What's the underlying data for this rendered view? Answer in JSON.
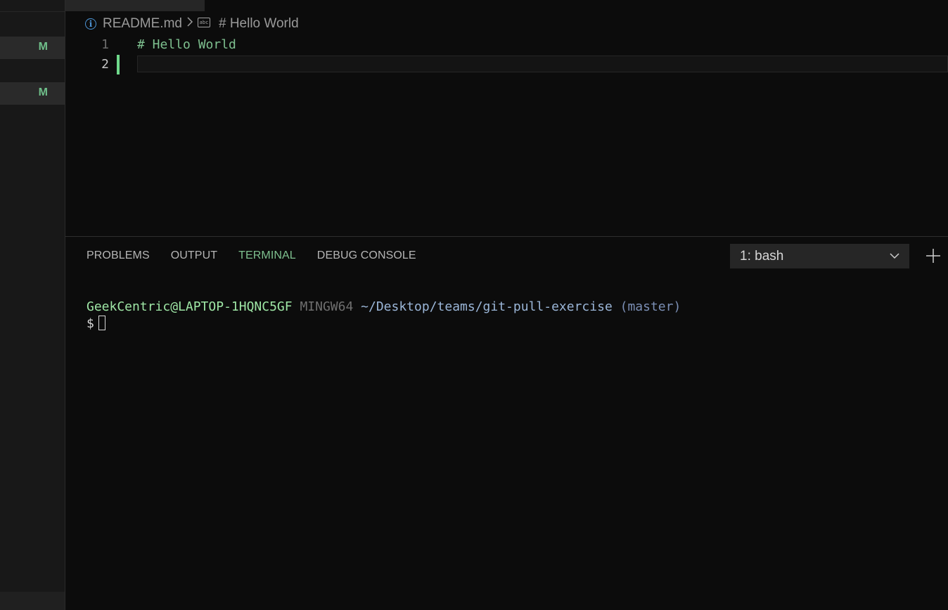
{
  "sidebar": {
    "badges": [
      "M",
      "M"
    ]
  },
  "breadcrumb": {
    "file": "README.md",
    "icon_label": "abc",
    "symbol": "# Hello World"
  },
  "editor": {
    "lines": [
      {
        "number": "1",
        "text": "# Hello World"
      },
      {
        "number": "2",
        "text": ""
      }
    ]
  },
  "panel": {
    "tabs": [
      "PROBLEMS",
      "OUTPUT",
      "TERMINAL",
      "DEBUG CONSOLE"
    ],
    "active_tab": "TERMINAL",
    "terminal_select": "1: bash"
  },
  "terminal": {
    "user": "GeekCentric@LAPTOP-1HQNC5GF",
    "system": "MINGW64",
    "path": "~/Desktop/teams/git-pull-exercise",
    "branch": "(master)",
    "prompt": "$"
  },
  "colors": {
    "accent": "#7ec08f",
    "modified": "#6fbf8a",
    "background": "#0c0c0c"
  }
}
